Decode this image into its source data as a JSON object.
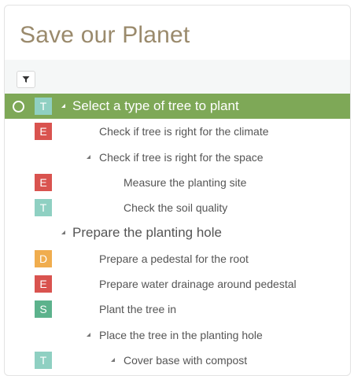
{
  "page": {
    "title": "Save our Planet"
  },
  "toolbar": {
    "filter_icon": "filter-icon"
  },
  "colors": {
    "title": "#9a8a6c",
    "selected_row": "#7ea857",
    "badge_E": "#d9534f",
    "badge_T": "#8fd0c2",
    "badge_D": "#f0ad4e",
    "badge_S": "#5cb28c"
  },
  "tree": {
    "rows": [
      {
        "badge": "T",
        "label": "Select a type of tree to plant",
        "expanded": true,
        "selected": true
      },
      {
        "badge": "E",
        "label": "Check if tree is right for the climate"
      },
      {
        "badge": "",
        "label": "Check if tree is right for the space",
        "expanded": true
      },
      {
        "badge": "E",
        "label": "Measure the planting site"
      },
      {
        "badge": "T",
        "label": "Check the soil quality"
      },
      {
        "badge": "",
        "label": "Prepare the planting hole",
        "expanded": true
      },
      {
        "badge": "D",
        "label": "Prepare a pedestal for the root"
      },
      {
        "badge": "E",
        "label": "Prepare water drainage around pedestal"
      },
      {
        "badge": "S",
        "label": "Plant the tree in"
      },
      {
        "badge": "",
        "label": "Place the tree in the planting hole",
        "expanded": true
      },
      {
        "badge": "T",
        "label": "Cover base with compost",
        "expanded": true
      }
    ]
  }
}
